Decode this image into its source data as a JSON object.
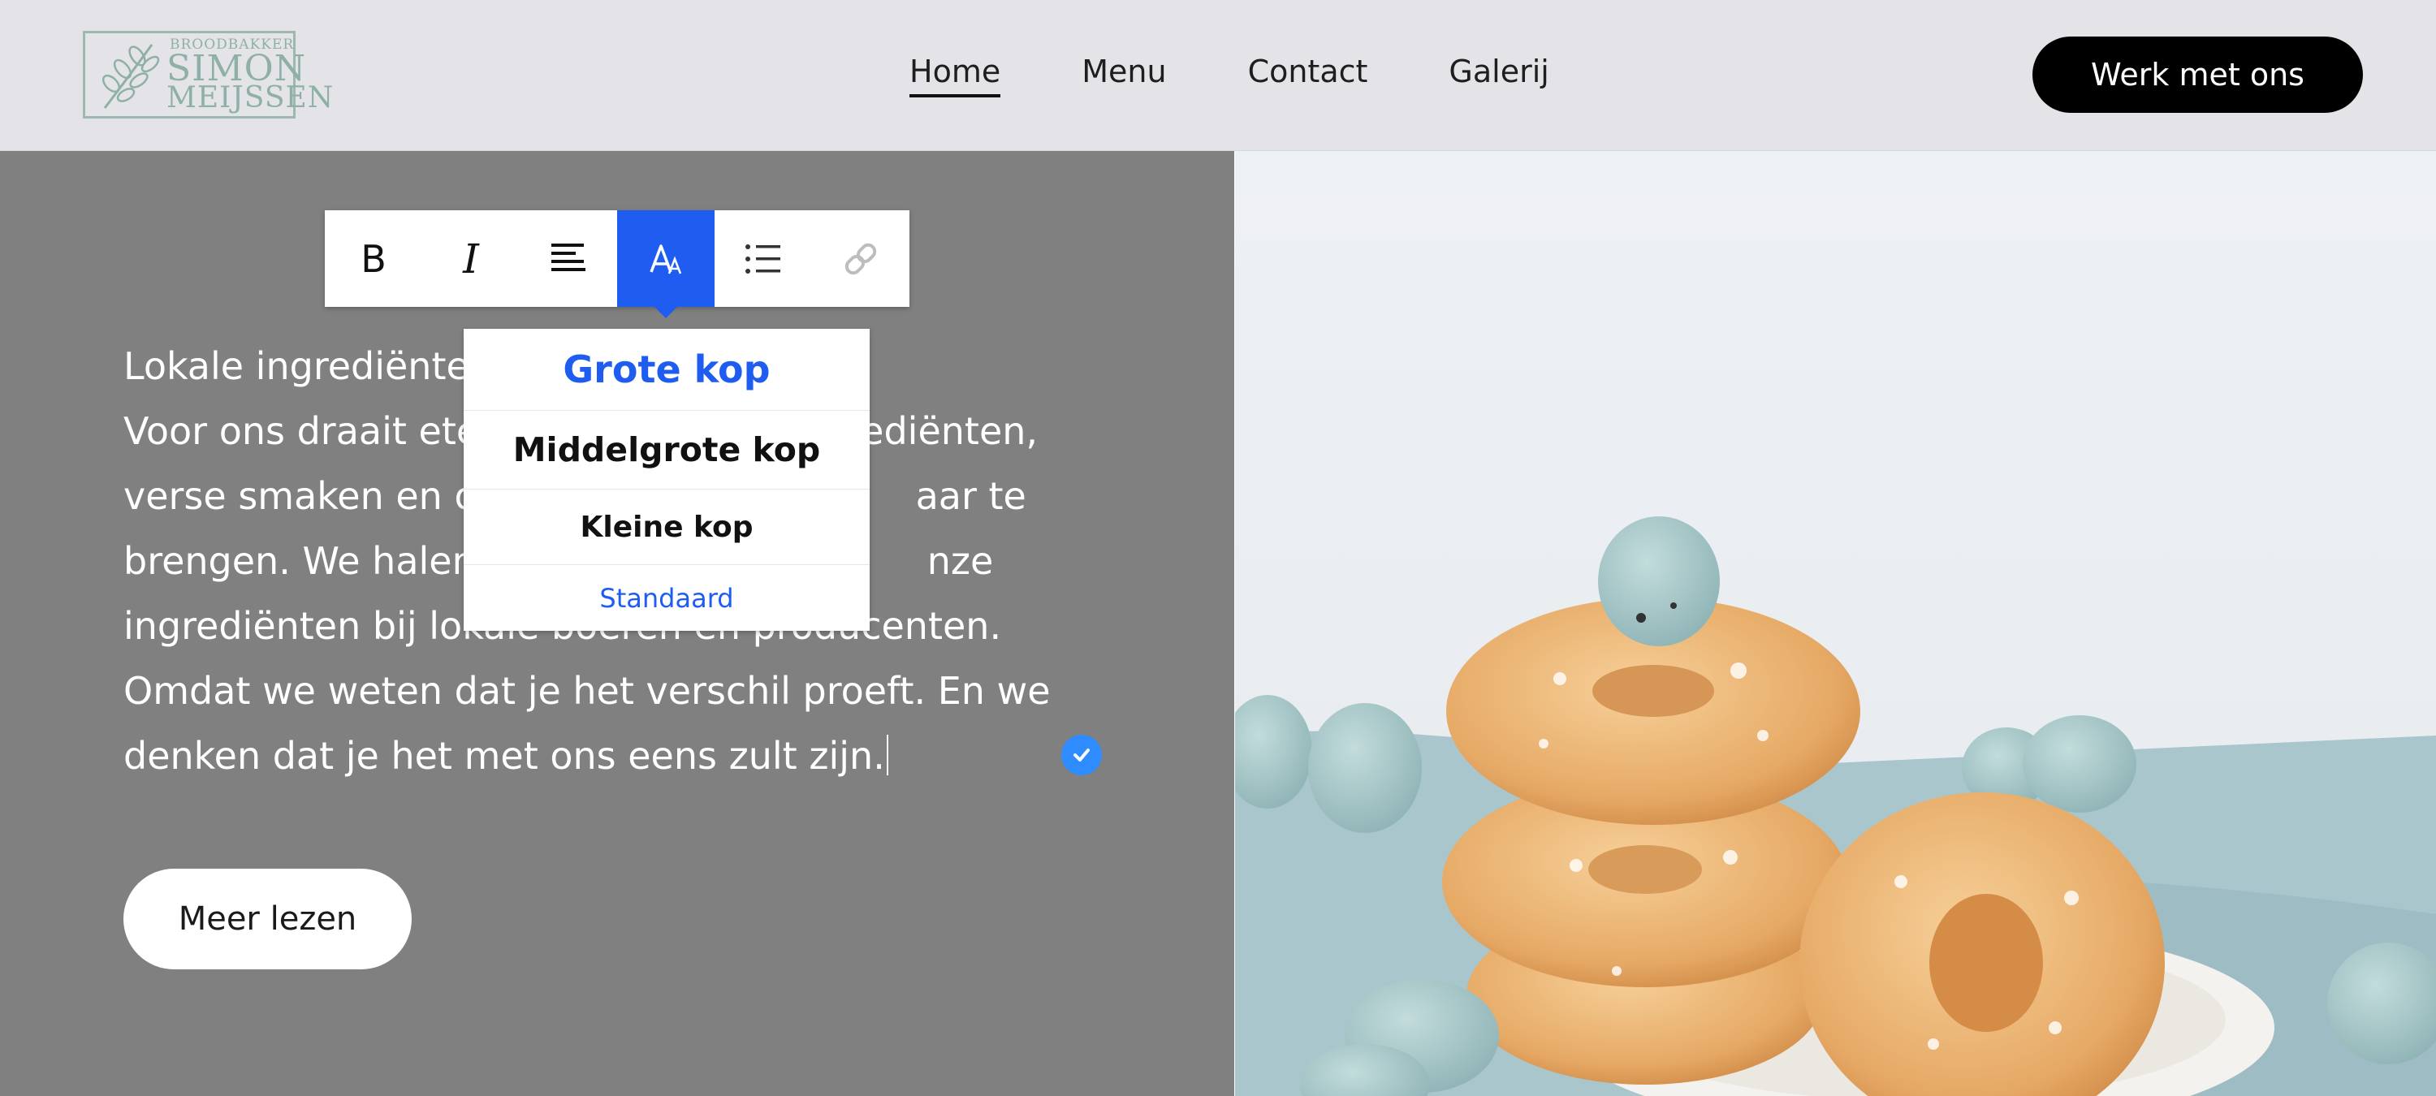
{
  "header": {
    "logo": {
      "line1": "BROODBAKKER",
      "line2": "SIMON",
      "line3": "MEIJSSEN"
    },
    "nav": [
      "Home",
      "Menu",
      "Contact",
      "Galerij"
    ],
    "active_nav": "Home",
    "cta_label": "Werk met ons"
  },
  "editor": {
    "toolbar": {
      "buttons": [
        "bold-icon",
        "italic-icon",
        "align-left-icon",
        "text-style-icon",
        "list-icon",
        "link-icon"
      ],
      "active": "text-style-icon"
    },
    "heading_menu": {
      "options": [
        "Grote kop",
        "Middelgrote kop",
        "Kleine kop",
        "Standaard"
      ]
    },
    "paragraph_lines": [
      "Lokale ingrediënte",
      "Voor ons draait ete",
      "verse smaken en o",
      "brengen. We halen",
      "ingrediënten bij lokale boeren en producenten.",
      "Omdat we weten dat je het verschil proeft. En we",
      "denken dat je het met ons eens zult zijn."
    ],
    "paragraph_tails": [
      "",
      "ediënten,",
      "aar te",
      "nze",
      "",
      "",
      ""
    ],
    "more_button": "Meer lezen"
  },
  "colors": {
    "accent": "#1f5cf0",
    "panel_bg": "#808080",
    "header_bg": "#e4e4e8",
    "badge": "#2f8cff"
  }
}
